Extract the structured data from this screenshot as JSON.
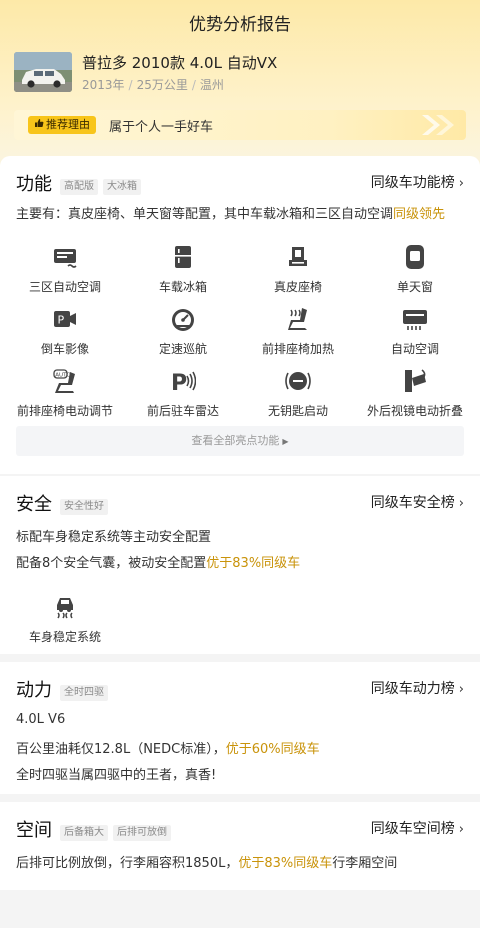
{
  "nav": {
    "title": "优势分析报告"
  },
  "car": {
    "title": "普拉多 2010款 4.0L 自动VX",
    "year": "2013年",
    "mileage": "25万公里",
    "city": "温州",
    "separator": "/"
  },
  "reason": {
    "tag": "推荐理由",
    "text": "属于个人一手好车"
  },
  "feature_section": {
    "title": "功能",
    "chips": [
      "高配版",
      "大冰箱"
    ],
    "rank_link": "同级车功能榜",
    "desc_prefix": "主要有：真皮座椅、单天窗等配置，其中车载冰箱和三区自动空调",
    "desc_highlight": "同级领先",
    "items": [
      {
        "label": "三区自动空调",
        "icon": "ac-panel-icon"
      },
      {
        "label": "车载冰箱",
        "icon": "fridge-icon"
      },
      {
        "label": "真皮座椅",
        "icon": "leather-seat-icon"
      },
      {
        "label": "单天窗",
        "icon": "sunroof-icon"
      },
      {
        "label": "倒车影像",
        "icon": "rear-camera-icon"
      },
      {
        "label": "定速巡航",
        "icon": "cruise-gauge-icon"
      },
      {
        "label": "前排座椅加热",
        "icon": "seat-heating-icon"
      },
      {
        "label": "自动空调",
        "icon": "auto-ac-icon"
      },
      {
        "label": "前排座椅电动调节",
        "icon": "power-seat-icon"
      },
      {
        "label": "前后驻车雷达",
        "icon": "parking-radar-icon"
      },
      {
        "label": "无钥匙启动",
        "icon": "keyless-start-icon"
      },
      {
        "label": "外后视镜电动折叠",
        "icon": "mirror-fold-icon"
      }
    ],
    "see_all": "查看全部亮点功能"
  },
  "safety_section": {
    "title": "安全",
    "chips": [
      "安全性好"
    ],
    "rank_link": "同级车安全榜",
    "line1": "标配车身稳定系统等主动安全配置",
    "line2_prefix": "配备8个安全气囊，被动安全配置",
    "line2_highlight": "优于83%同级车",
    "item": {
      "label": "车身稳定系统",
      "icon": "stability-control-icon"
    }
  },
  "power_section": {
    "title": "动力",
    "chips": [
      "全时四驱"
    ],
    "rank_link": "同级车动力榜",
    "line1": "4.0L V6",
    "line2_prefix": "百公里油耗仅12.8L（NEDC标准），",
    "line2_highlight": "优于60%同级车",
    "line3": "全时四驱当属四驱中的王者，真香!"
  },
  "space_section": {
    "title": "空间",
    "chips": [
      "后备箱大",
      "后排可放倒"
    ],
    "rank_link": "同级车空间榜",
    "line1_prefix": "后排可比例放倒，行李厢容积1850L，",
    "line1_highlight": "优于83%同级车",
    "line1_suffix": "行李厢空间"
  },
  "colors": {
    "accent": "#f8c51a",
    "highlight_text": "#c9930a",
    "header_gradient_top": "#fde9a8"
  }
}
